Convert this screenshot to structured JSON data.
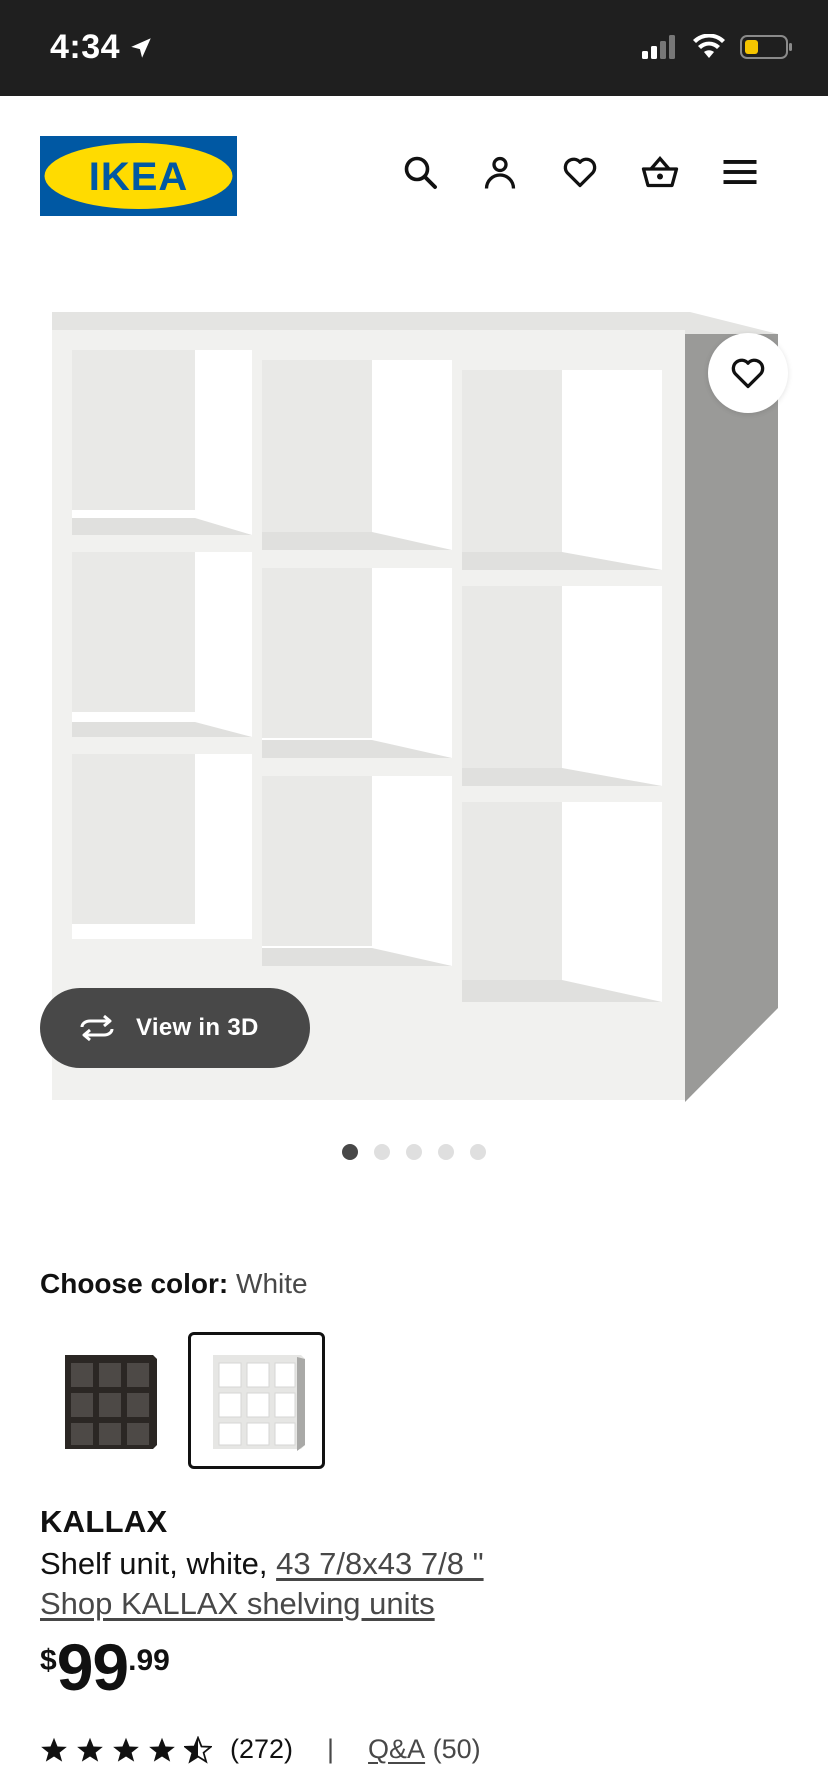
{
  "status_bar": {
    "time": "4:34",
    "icons": [
      "location-arrow-icon",
      "signal-icon",
      "wifi-icon",
      "battery-icon"
    ],
    "battery_color": "#f5c400"
  },
  "header": {
    "logo_text": "IKEA",
    "logo_colors": {
      "blue": "#0058a3",
      "yellow": "#ffdb00"
    },
    "icons": [
      "search-icon",
      "account-icon",
      "favorites-icon",
      "cart-icon",
      "menu-icon"
    ]
  },
  "gallery": {
    "view_3d_label": "View in 3D",
    "image_count": 5,
    "active_index": 0
  },
  "color": {
    "label": "Choose color:",
    "value": "White",
    "options": [
      "Black-brown",
      "White"
    ],
    "selected_index": 1
  },
  "product": {
    "name": "KALLAX",
    "description": "Shelf unit, white, ",
    "size_link": "43 7/8x43 7/8 \"",
    "shop_link": "Shop KALLAX shelving units"
  },
  "price": {
    "currency": "$",
    "integer": "99",
    "decimal": ".99"
  },
  "rating": {
    "stars": 4.5,
    "count": "(272)",
    "separator": "|",
    "qa_label": "Q&A",
    "qa_count": " (50)"
  }
}
